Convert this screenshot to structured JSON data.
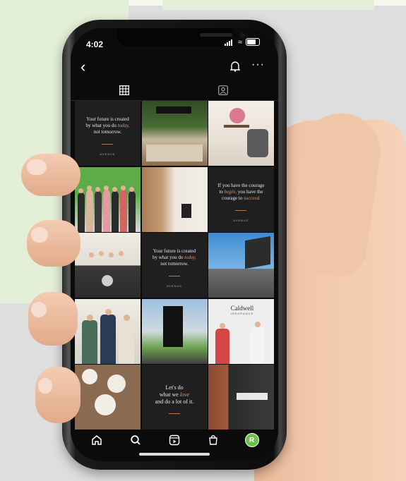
{
  "status_bar": {
    "time": "4:02"
  },
  "profile_tabs": {
    "grid": "grid-icon",
    "tagged": "tagged-icon"
  },
  "posts": [
    {
      "kind": "quote",
      "text_a": "Your future is created",
      "text_b": "by what you do",
      "script": "today,",
      "text_c": "not tomorrow.",
      "brand": "AVENUE"
    },
    {
      "kind": "photo",
      "scene": "green wall reception"
    },
    {
      "kind": "photo",
      "scene": "flowers and chairs"
    },
    {
      "kind": "photo",
      "scene": "team group photo green wall"
    },
    {
      "kind": "photo",
      "scene": "hallway wooden doors"
    },
    {
      "kind": "quote",
      "text_a": "If you have the courage",
      "script": "begin,",
      "text_b": "to",
      "text_c": "you have the",
      "text_d": "courage to",
      "script2": "succeed.",
      "brand": "AVENUE"
    },
    {
      "kind": "photo",
      "scene": "team at desk"
    },
    {
      "kind": "quote",
      "text_a": "Your future is created",
      "text_b": "by what you do",
      "script": "today,",
      "text_c": "not tomorrow.",
      "brand": "AVENUE"
    },
    {
      "kind": "photo",
      "scene": "building sky"
    },
    {
      "kind": "photo",
      "scene": "three people"
    },
    {
      "kind": "photo",
      "scene": "directory sign"
    },
    {
      "kind": "photo",
      "scene": "caldwell insurance",
      "sign": "Caldwell",
      "sign_sub": "INSURANCE"
    },
    {
      "kind": "photo",
      "scene": "food table"
    },
    {
      "kind": "quote",
      "text_a": "Let's do",
      "text_b": "what we",
      "script": "love",
      "text_c": "and do a lot of it."
    },
    {
      "kind": "photo",
      "scene": "avenue storefront"
    }
  ],
  "nav": {
    "items": [
      "home-icon",
      "search-icon",
      "reels-icon",
      "shop-icon",
      "profile-avatar"
    ],
    "avatar_letter": "R",
    "avatar_color": "#6cc04a"
  }
}
